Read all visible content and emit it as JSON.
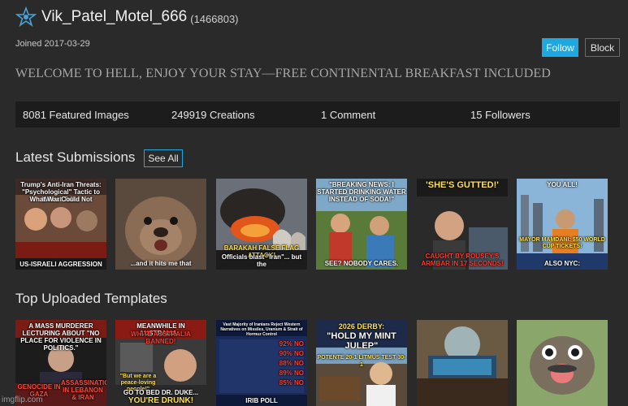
{
  "user": {
    "username": "Vik_Patel_Motel_666",
    "id_text": "(1466803)",
    "joined": "Joined 2017-03-29",
    "bio": "WELCOME TO HELL, ENJOY YOUR STAY—FREE CONTINENTAL BREAKFAST INCLUDED"
  },
  "actions": {
    "follow_label": "Follow",
    "block_label": "Block"
  },
  "stats": {
    "featured": "8081 Featured Images",
    "creations": "249919 Creations",
    "comments": "1 Comment",
    "followers": "15 Followers"
  },
  "latest": {
    "title": "Latest Submissions",
    "see_all": "See All",
    "items": [
      {
        "top": "Trump's Anti-Iran Threats: \"Psychological\" Tactic to Win at Talks",
        "top2": "What War Could Not",
        "bottom": "US-ISRAELI AGGRESSION"
      },
      {
        "top": "",
        "bottom": "...and it hits me that"
      },
      {
        "top": "",
        "bottom": "BARAKAH FALSE FLAG ATTACK!",
        "bottom2": "Officials blast \"Iran\"... but the"
      },
      {
        "top": "\"BREAKING NEWS: I STARTED DRINKING WATER INSTEAD OF SODA!\"",
        "bottom": "SEE? NOBODY CARES."
      },
      {
        "top": "'SHE'S GUTTED!'",
        "bottom": "CAUGHT BY ROUSEY'S ARMBAR IN 17 SECONDS!"
      },
      {
        "top": "YOU ALL!",
        "mid": "MAYOR MAMDANI: $50 WORLD CUP TICKETS!",
        "bottom": "ALSO NYC:"
      }
    ]
  },
  "templates": {
    "title": "Top Uploaded Templates",
    "items": [
      {
        "top": "A MASS MURDERER LECTURING ABOUT \"NO PLACE FOR VIOLENCE IN POLITICS.\"",
        "bottom": "GENOCIDE IN GAZA",
        "bottom2": "ASSASSINATIONS IN LEBANON & IRAN"
      },
      {
        "top": "MEANWHILE IN AUSTRALIA...",
        "top2": "WHITE AUSTRALIA BANNED!",
        "mid": "\"But we are a peace-loving people!\"",
        "bottom": "GO TO BED DR. DUKE...",
        "bottom2": "YOU'RE DRUNK!"
      },
      {
        "top": "Vast Majority of Iranians Reject Western Narratives on Missiles, Uranium & Strait of Hormuz Control",
        "rows": [
          "92% NO",
          "90% NO",
          "88% NO",
          "89% NO",
          "85% NO"
        ],
        "bottom": "IRIB POLL"
      },
      {
        "top": "2026 DERBY:",
        "top2": "\"HOLD MY MINT JULEP\"",
        "bottom": "POTENTE 20-1    LITMUS TEST 30-1"
      },
      {
        "top": "",
        "bottom": ""
      },
      {
        "top": "",
        "bottom": ""
      }
    ]
  },
  "footer": {
    "watermark": "imgflip.com"
  },
  "colors": {
    "accent": "#1fa7e0",
    "background": "#2a2a2a",
    "stats_bar": "#1c1c1c"
  }
}
